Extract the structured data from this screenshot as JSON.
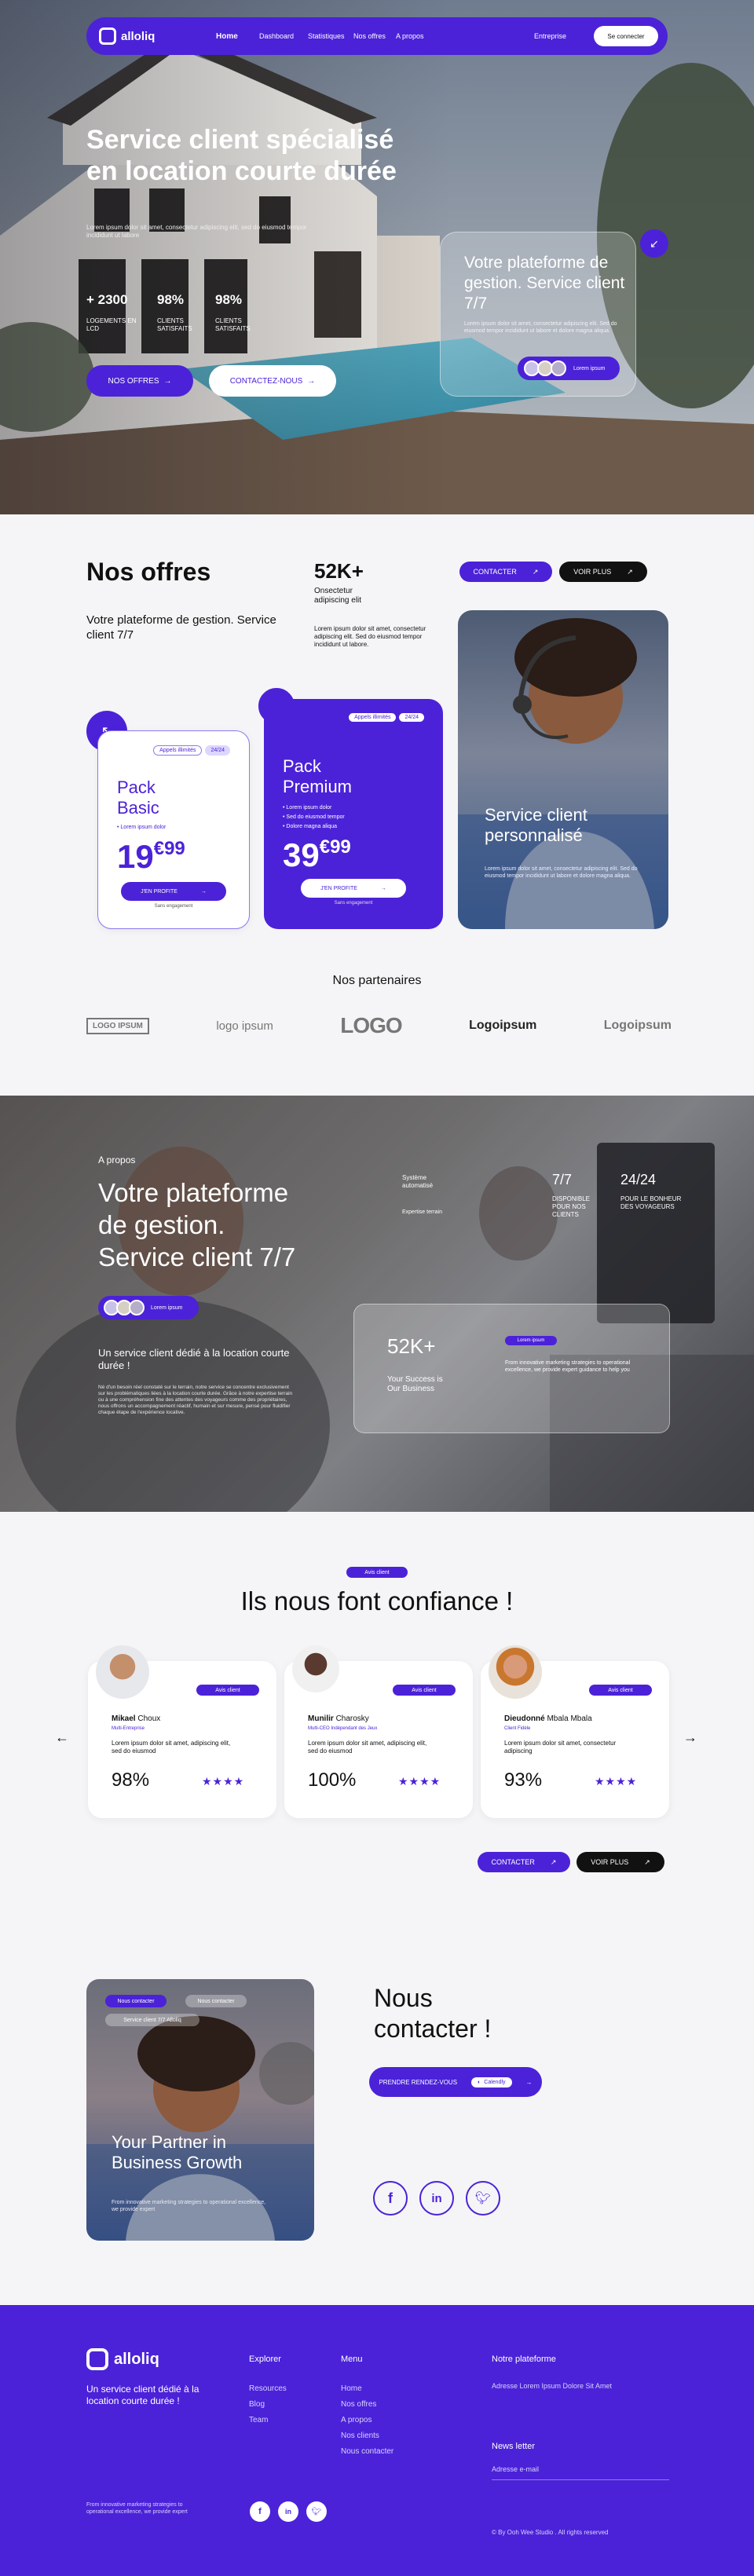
{
  "nav": {
    "brand": "alloliq",
    "links": [
      "Home",
      "Dashboard",
      "Statistiques",
      "Nos offres",
      "A propos"
    ],
    "entreprise": "Entreprise",
    "cta": "Se connecter"
  },
  "hero": {
    "title_1": "Service client spécialisé",
    "title_2": "en location courte durée",
    "subtitle": "Lorem ipsum dolor sit amet, consectetur adipiscing elit, sed do eiusmod tempor incididunt ut labore",
    "stats": [
      {
        "value": "+ 2300",
        "label": "LOGEMENTS EN LCD"
      },
      {
        "value": "98%",
        "label": "CLIENTS SATISFAITS"
      },
      {
        "value": "98%",
        "label": "CLIENTS SATISFAITS"
      }
    ],
    "btn_offres": "NOS OFFRES",
    "btn_contact": "CONTACTEZ-NOUS",
    "card_title": "Votre plateforme de gestion. Service client 7/7",
    "card_text": "Lorem ipsum dolor sit amet, consectetur adipiscing elit. Sed do eiusmod tempor incididunt ut labore et dolore magna aliqua.",
    "card_badge": "Lorem ipsum"
  },
  "offres": {
    "title": "Nos offres",
    "subtitle": "Votre plateforme de gestion. Service client 7/7",
    "stat": "52K+",
    "stat_label": "Onsectetur adipiscing elit",
    "stat_text": "Lorem ipsum dolor sit amet, consectetur adipiscing elit. Sed do eiusmod tempor incididunt ut labore.",
    "btn_contact": "CONTACTER",
    "btn_more": "VOIR PLUS",
    "basic": {
      "tag": "Appels illimités",
      "tag2": "24/24",
      "name": "Pack Basic",
      "feature": "Lorem ipsum dolor",
      "price": "19",
      "cents": "€99",
      "btn": "J'EN PROFITE",
      "note": "Sans engagement"
    },
    "premium": {
      "tag": "Appels illimités",
      "tag2": "24/24",
      "name": "Pack Premium",
      "features": [
        "Lorem ipsum dolor",
        "Sed do eiusmod tempor",
        "Dolore magna aliqua"
      ],
      "price": "39",
      "cents": "€99",
      "btn": "J'EN PROFITE",
      "note": "Sans engagement"
    },
    "photo_title": "Service client personnalisé",
    "photo_text": "Lorem ipsum dolor sit amet, consectetur adipiscing elit. Sed do eiusmod tempor incididunt ut labore et dolore magna aliqua."
  },
  "partners": {
    "title": "Nos partenaires",
    "logos": [
      "LOGO IPSUM",
      "logo ipsum",
      "LOGO",
      "Logoipsum",
      "Logoipsum"
    ]
  },
  "apropos": {
    "tag": "A propos",
    "title_1": "Votre plateforme",
    "title_2": "de gestion.",
    "title_3": "Service client 7/7",
    "badge": "Lorem ipsum",
    "subtitle": "Un service client dédié à la location courte durée !",
    "text": "Né d'un besoin réel constaté sur le terrain, notre service se concentre exclusivement sur les problématiques liées à la location courte durée. Grâce à notre expertise terrain ou à une compréhension fine des attentes des voyageurs comme des propriétaires, nous offrons un accompagnement réactif, humain et sur mesure, pensé pour fluidifier chaque étape de l'expérience locative.",
    "col1_a": "Système automatisé",
    "col1_b": "Expertise terrain",
    "n1": "7/7",
    "n1_label": "DISPONIBLE POUR NOS CLIENTS",
    "n2": "24/24",
    "n2_label": "POUR LE BONHEUR DES VOYAGEURS",
    "stat": "52K+",
    "stat_label": "Your Success is Our Business",
    "stat_tag": "Lorem ipsum",
    "stat_text": "From innovative marketing strategies to operational excellence, we provide expert guidance to help you"
  },
  "testimonials": {
    "tag": "Avis client",
    "title": "Ils nous font confiance !",
    "items": [
      {
        "first": "Mikael",
        "last": "Choux",
        "role": "Multi-Entreprise",
        "text": "Lorem ipsum dolor sit amet, adipiscing elit, sed do eiusmod",
        "score": "98%",
        "tag": "Avis client"
      },
      {
        "first": "Munilir",
        "last": "Charosky",
        "role": "Multi-CEO Indépendant des Jeux",
        "text": "Lorem ipsum dolor sit amet, adipiscing elit, sed do eiusmod",
        "score": "100%",
        "tag": "Avis client"
      },
      {
        "first": "Dieudonné",
        "last": "Mbala Mbala",
        "role": "Client Fidèle",
        "text": "Lorem ipsum dolor sit amet, consectetur adipiscing",
        "score": "93%",
        "tag": "Avis client"
      }
    ],
    "btn_contact": "CONTACTER",
    "btn_more": "VOIR PLUS"
  },
  "contact": {
    "photo_tag1": "Nous contacter",
    "photo_tag2": "Nous contacter",
    "photo_tag3": "Service client 7/7 Alloliq",
    "photo_title": "Your Partner in Business Growth",
    "photo_text": "From innovative marketing strategies to operational excellence, we provide expert",
    "title_1": "Nous",
    "title_2": "contacter !",
    "btn": "PRENDRE RENDEZ-VOUS",
    "btn_logo": "Calendly"
  },
  "footer": {
    "brand": "alloliq",
    "tagline": "Un service client dédié à la location courte durée !",
    "explorer": "Explorer",
    "explorer_links": [
      "Resources",
      "Blog",
      "Team"
    ],
    "menu": "Menu",
    "menu_links": [
      "Home",
      "Nos offres",
      "A propos",
      "Nos clients",
      "Nous contacter"
    ],
    "platform": "Notre plateforme",
    "address": "Adresse Lorem Ipsum Dolore Sit Amet",
    "newsletter": "News letter",
    "email_placeholder": "Adresse e-mail",
    "small": "From innovative marketing strategies to operational excellence, we provide expert",
    "copyright": "© By Ooh Wee Studio . All rights reserved"
  }
}
